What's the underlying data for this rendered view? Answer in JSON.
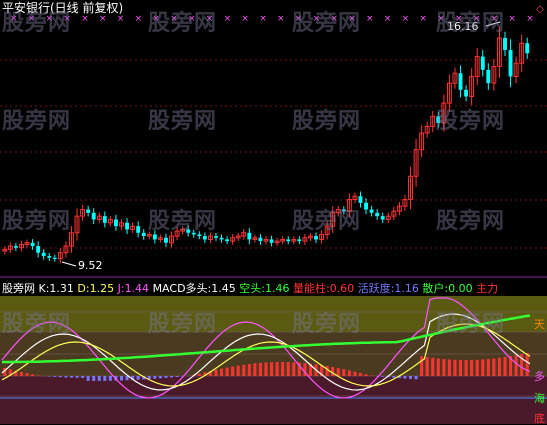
{
  "title": "平安银行(日线 前复权)",
  "price_high_label": "16.16",
  "price_low_label": "9.52",
  "watermark": "股旁网",
  "indicator": {
    "name": "股旁网",
    "k_label": "K:",
    "k_value": "1.31",
    "d_label": "D:",
    "d_value": "1.25",
    "j_label": "J:",
    "j_value": "1.44",
    "macd_label": "MACD多头:",
    "macd_value": "1.45",
    "kong_label": "空头:",
    "kong_value": "1.46",
    "lnz_label": "量能柱:",
    "lnz_value": "0.60",
    "hyd_label": "活跃度:",
    "hyd_value": "1.16",
    "sh_label": "散户:",
    "sh_value": "0.00",
    "zl_label": "主力"
  },
  "side_labels": [
    "天",
    "多",
    "海",
    "底"
  ],
  "colors": {
    "up": "#ff3333",
    "down": "#00ffff",
    "grid": "#7a1010",
    "x_marker": "#ff55ff",
    "k_color": "#ffffff",
    "d_color": "#ffff55",
    "j_color": "#ff55ff",
    "macd_color": "#ffffff",
    "kong_color": "#33ff33",
    "lnz_color": "#ff3333",
    "hyd_color": "#7777ff",
    "sh_color": "#33ff33",
    "zl_color": "#ff3333"
  },
  "chart_data": {
    "type": "candlestick",
    "title": "平安银行(日线 前复权)",
    "high": 16.16,
    "low": 9.52,
    "closes": [
      9.8,
      9.9,
      9.85,
      9.95,
      10.0,
      9.9,
      9.7,
      9.6,
      9.55,
      9.52,
      9.7,
      9.9,
      10.3,
      10.8,
      11.0,
      10.9,
      10.7,
      10.8,
      10.6,
      10.7,
      10.5,
      10.6,
      10.4,
      10.5,
      10.3,
      10.2,
      10.25,
      10.1,
      10.15,
      10.0,
      10.2,
      10.35,
      10.4,
      10.3,
      10.25,
      10.2,
      10.1,
      10.2,
      10.15,
      10.1,
      10.05,
      10.15,
      10.2,
      10.3,
      10.1,
      10.15,
      10.05,
      10.1,
      10.0,
      10.05,
      10.1,
      10.05,
      10.1,
      10.05,
      10.15,
      10.2,
      10.1,
      10.25,
      10.5,
      10.9,
      11.0,
      10.95,
      11.3,
      11.4,
      11.2,
      11.0,
      10.9,
      10.8,
      10.7,
      10.8,
      10.95,
      11.1,
      11.3,
      12.0,
      12.8,
      13.3,
      13.5,
      13.8,
      13.6,
      14.2,
      14.8,
      15.1,
      14.6,
      14.4,
      15.0,
      15.6,
      15.2,
      14.8,
      15.3,
      16.16,
      15.8,
      15.0,
      15.4,
      16.0,
      15.7
    ]
  }
}
